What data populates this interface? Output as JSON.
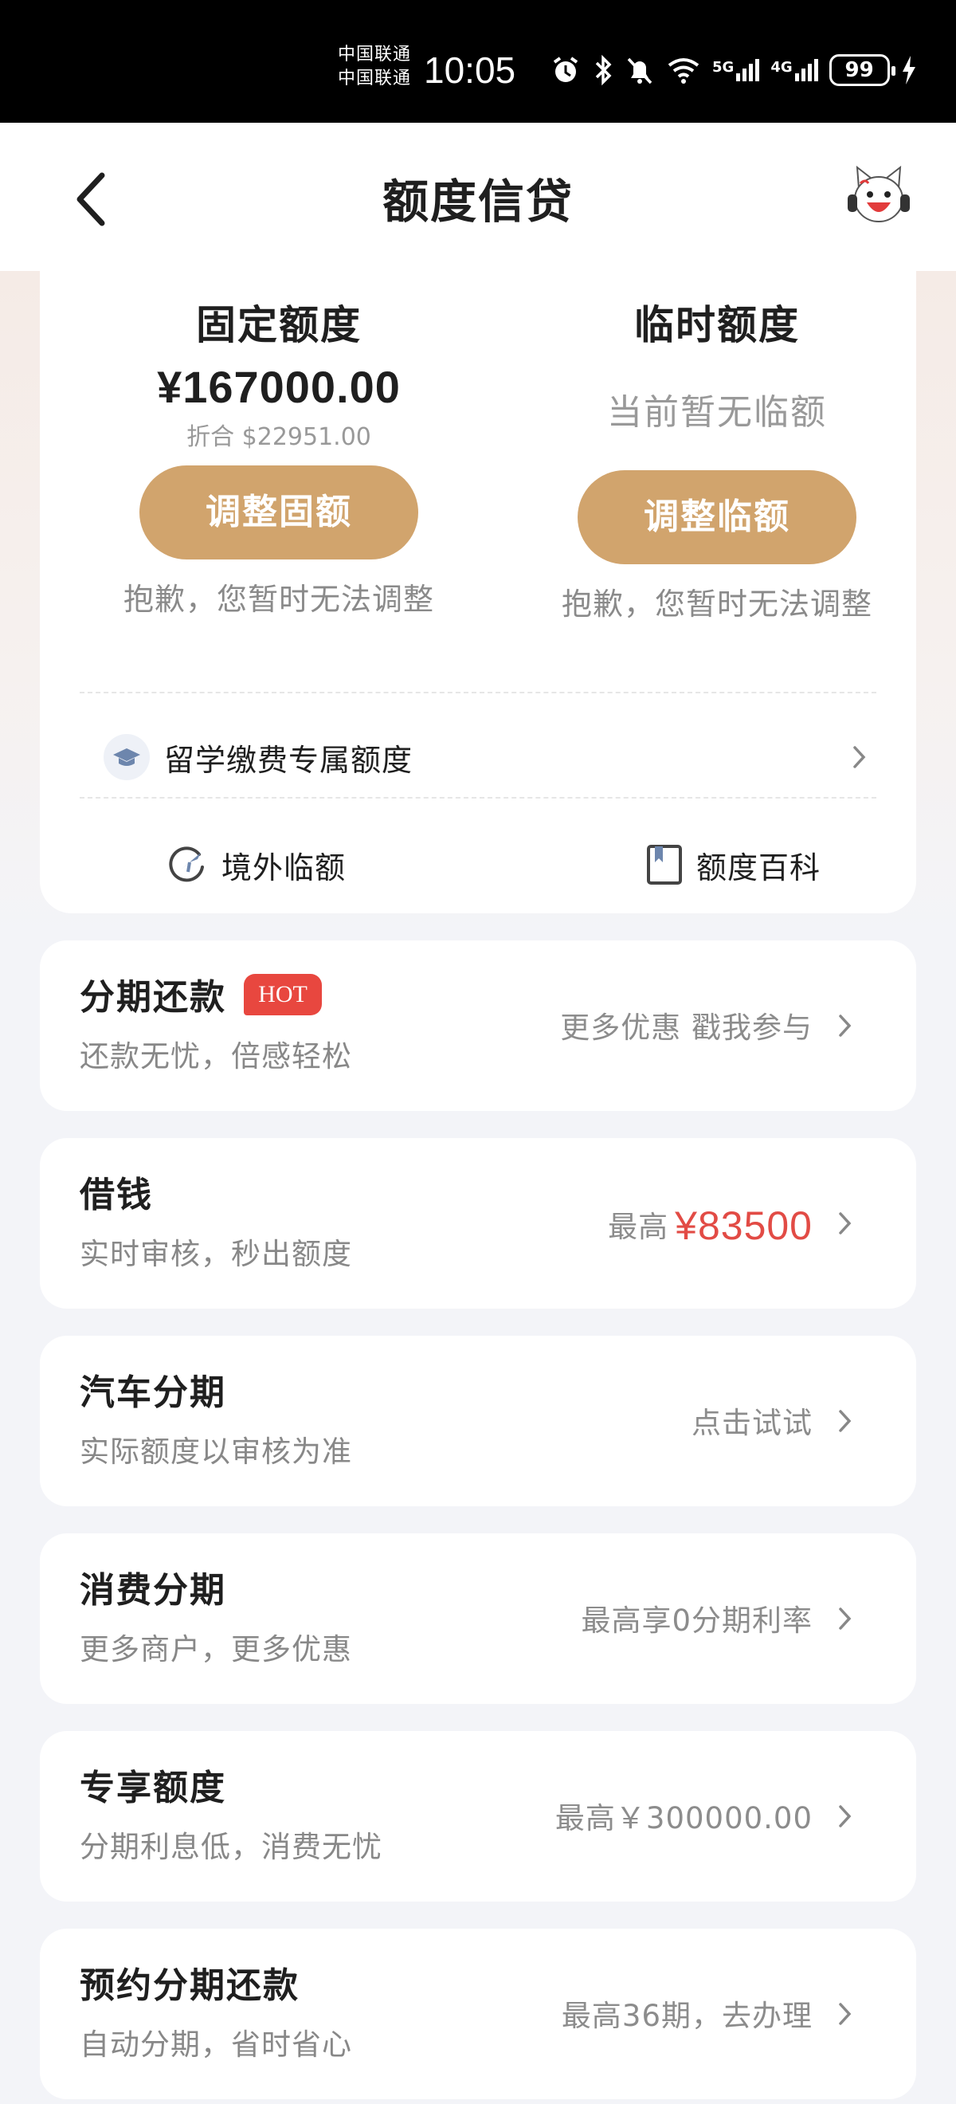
{
  "status_bar": {
    "carrier1": "中国联通",
    "carrier2": "中国联通",
    "time": "10:05",
    "network1": "5G",
    "network2": "4G",
    "battery": "99"
  },
  "nav": {
    "title": "额度信贷"
  },
  "quota": {
    "fixed": {
      "label": "固定额度",
      "amount": "¥167000.00",
      "converted": "折合 $22951.00",
      "button": "调整固额",
      "note": "抱歉，您暂时无法调整"
    },
    "temporary": {
      "label": "临时额度",
      "status": "当前暂无临额",
      "button": "调整临额",
      "note": "抱歉，您暂时无法调整"
    },
    "study_row": "留学缴费专属额度",
    "shortcuts": [
      "境外临额",
      "额度百科"
    ]
  },
  "services": [
    {
      "title": "分期还款",
      "badge": "HOT",
      "desc": "还款无忧，倍感轻松",
      "right": "更多优惠 戳我参与"
    },
    {
      "title": "借钱",
      "desc": "实时审核，秒出额度",
      "right_prefix": "最高",
      "right_amount": "¥83500"
    },
    {
      "title": "汽车分期",
      "desc": "实际额度以审核为准",
      "right": "点击试试"
    },
    {
      "title": "消费分期",
      "desc": "更多商户，更多优惠",
      "right": "最高享0分期利率"
    },
    {
      "title": "专享额度",
      "desc": "分期利息低，消费无忧",
      "right": "最高￥300000.00"
    },
    {
      "title": "预约分期还款",
      "desc": "自动分期，省时省心",
      "right": "最高36期，去办理"
    }
  ],
  "colors": {
    "accent_gold": "#d1a46d",
    "hot_red": "#e8473f",
    "amount_red": "#e24b45"
  }
}
